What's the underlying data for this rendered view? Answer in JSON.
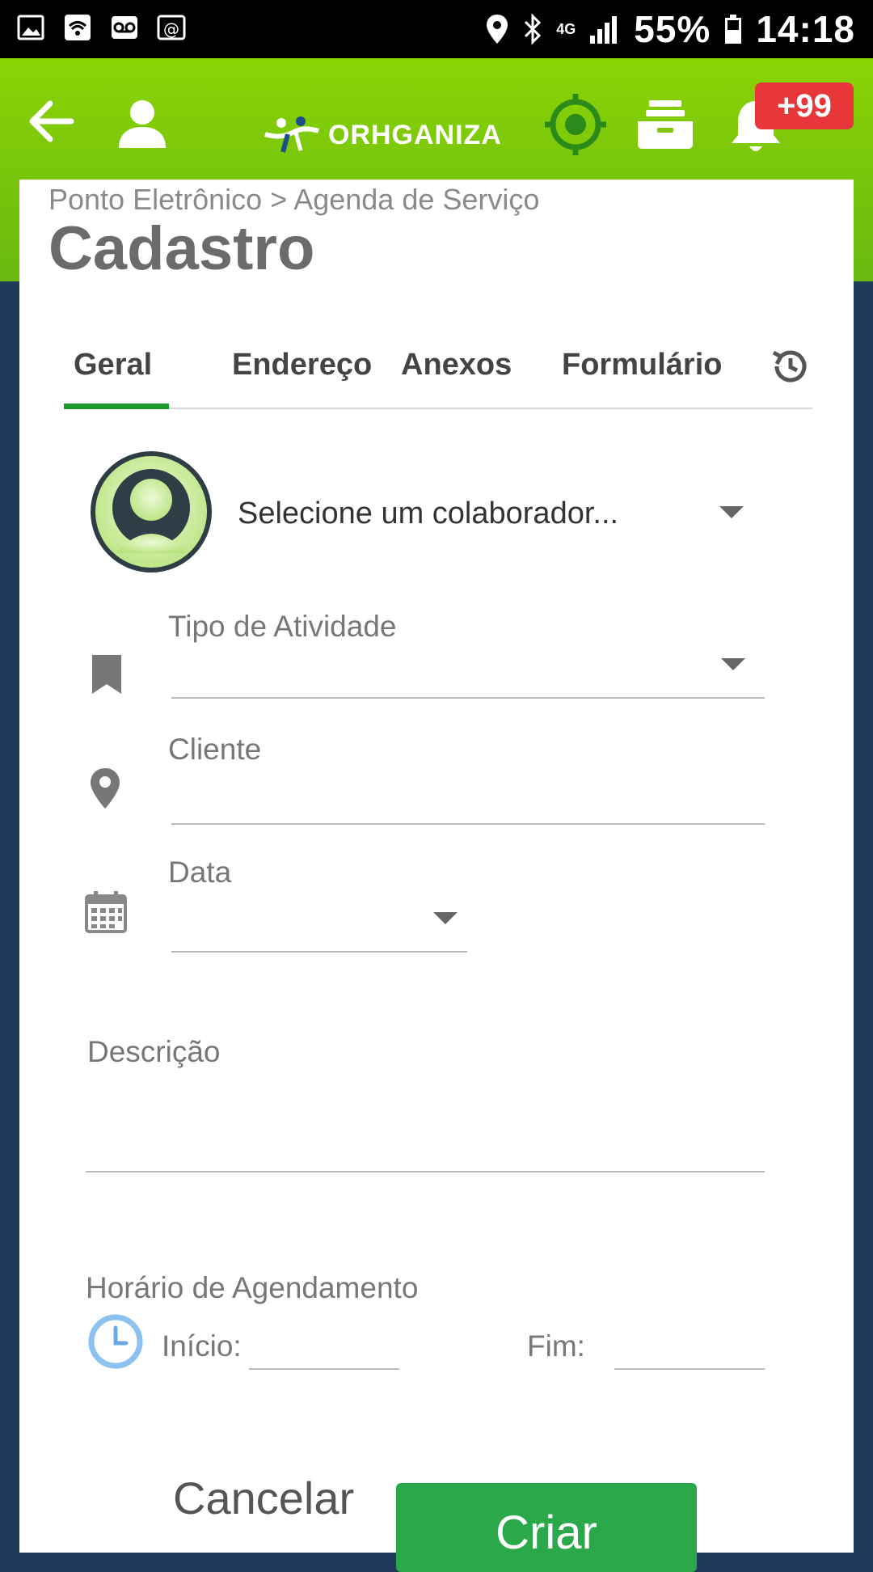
{
  "status_bar": {
    "battery": "55%",
    "time": "14:18",
    "network": "4G"
  },
  "header": {
    "logo_text": "ORHGANIZA",
    "notification_badge": "+99",
    "brand_color": "#7ccb0a"
  },
  "breadcrumb": "Ponto Eletrônico > Agenda de Serviço",
  "page_title": "Cadastro",
  "tabs": [
    {
      "label": "Geral",
      "active": true
    },
    {
      "label": "Endereço",
      "active": false
    },
    {
      "label": "Anexos",
      "active": false
    },
    {
      "label": "Formulário",
      "active": false
    }
  ],
  "form": {
    "colaborador_placeholder": "Selecione um colaborador...",
    "tipo_atividade_label": "Tipo de Atividade",
    "cliente_label": "Cliente",
    "data_label": "Data",
    "descricao_label": "Descrição",
    "horario_label": "Horário de Agendamento",
    "inicio_label": "Início:",
    "fim_label": "Fim:"
  },
  "actions": {
    "cancel_label": "Cancelar",
    "create_label": "Criar",
    "create_color": "#2ba84a"
  }
}
